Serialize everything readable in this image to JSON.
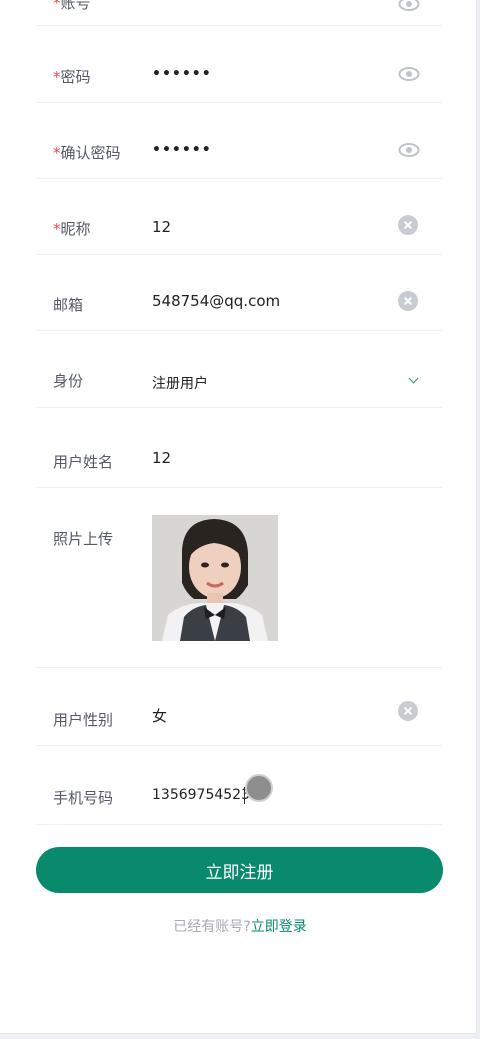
{
  "fields": [
    {
      "key": "account",
      "label": "账号",
      "required": true,
      "value": "",
      "icon": "eye-icon"
    },
    {
      "key": "password",
      "label": "密码",
      "required": true,
      "value": "••••••",
      "icon": "eye-icon"
    },
    {
      "key": "confirm_password",
      "label": "确认密码",
      "required": true,
      "value": "••••••",
      "icon": "eye-icon"
    },
    {
      "key": "nickname",
      "label": "昵称",
      "required": true,
      "value": "12",
      "icon": "clear-icon"
    },
    {
      "key": "email",
      "label": "邮箱",
      "required": false,
      "value": "548754@qq.com",
      "icon": "clear-icon"
    },
    {
      "key": "identity",
      "label": "身份",
      "required": false,
      "value": "注册用户",
      "icon": "chevron-down-icon"
    },
    {
      "key": "real_name",
      "label": "用户姓名",
      "required": false,
      "value": "12"
    },
    {
      "key": "photo",
      "label": "照片上传",
      "required": false
    },
    {
      "key": "gender",
      "label": "用户性别",
      "required": false,
      "value": "女",
      "icon": "clear-icon"
    },
    {
      "key": "phone",
      "label": "手机号码",
      "required": false,
      "value": "13569754523"
    }
  ],
  "required_mark": "*",
  "submit_label": "立即注册",
  "login_prompt": "已经有账号?",
  "login_link": "立即登录",
  "colors": {
    "accent": "#0a8a6c",
    "required": "#e24b4b"
  }
}
